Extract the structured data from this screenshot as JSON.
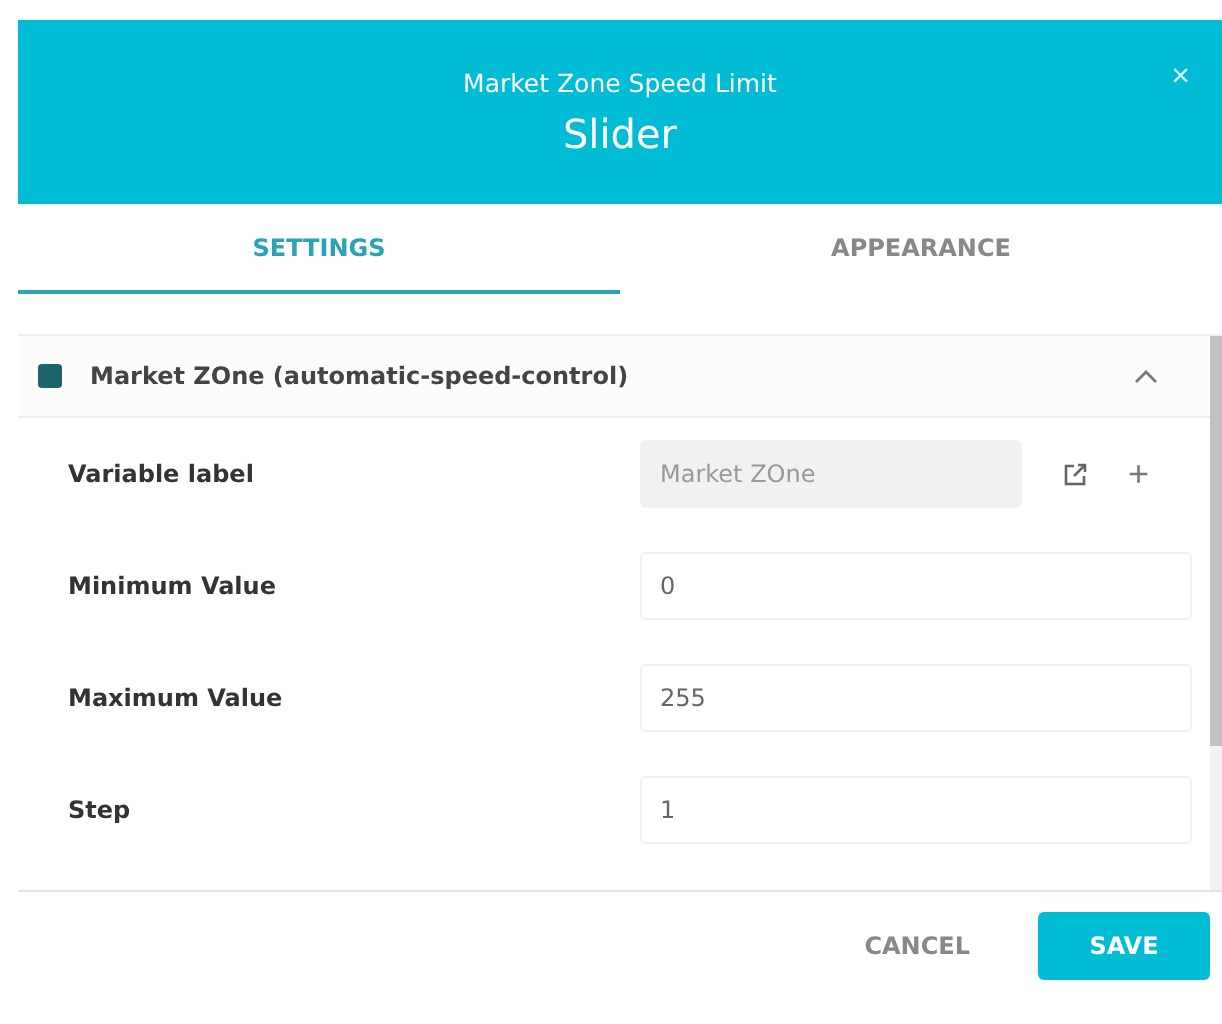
{
  "header": {
    "subtitle": "Market Zone Speed Limit",
    "title": "Slider",
    "close": "×"
  },
  "tabs": [
    {
      "label": "SETTINGS",
      "selected": true
    },
    {
      "label": "APPEARANCE",
      "selected": false
    }
  ],
  "section": {
    "color": "#1b6368",
    "title": "Market ZOne (automatic-speed-control)",
    "expanded": true
  },
  "rows": [
    {
      "label": "Variable label",
      "value": "Market ZOne",
      "disabled": true,
      "actions": [
        "+"
      ]
    },
    {
      "label": "Minimum Value",
      "value": "0",
      "disabled": false
    },
    {
      "label": "Maximum Value",
      "value": "255",
      "disabled": false
    },
    {
      "label": "Step",
      "value": "1",
      "disabled": false
    }
  ],
  "buttons": [
    {
      "label": "CANCEL",
      "kind": "flat"
    },
    {
      "label": "SAVE",
      "kind": "primary"
    }
  ]
}
